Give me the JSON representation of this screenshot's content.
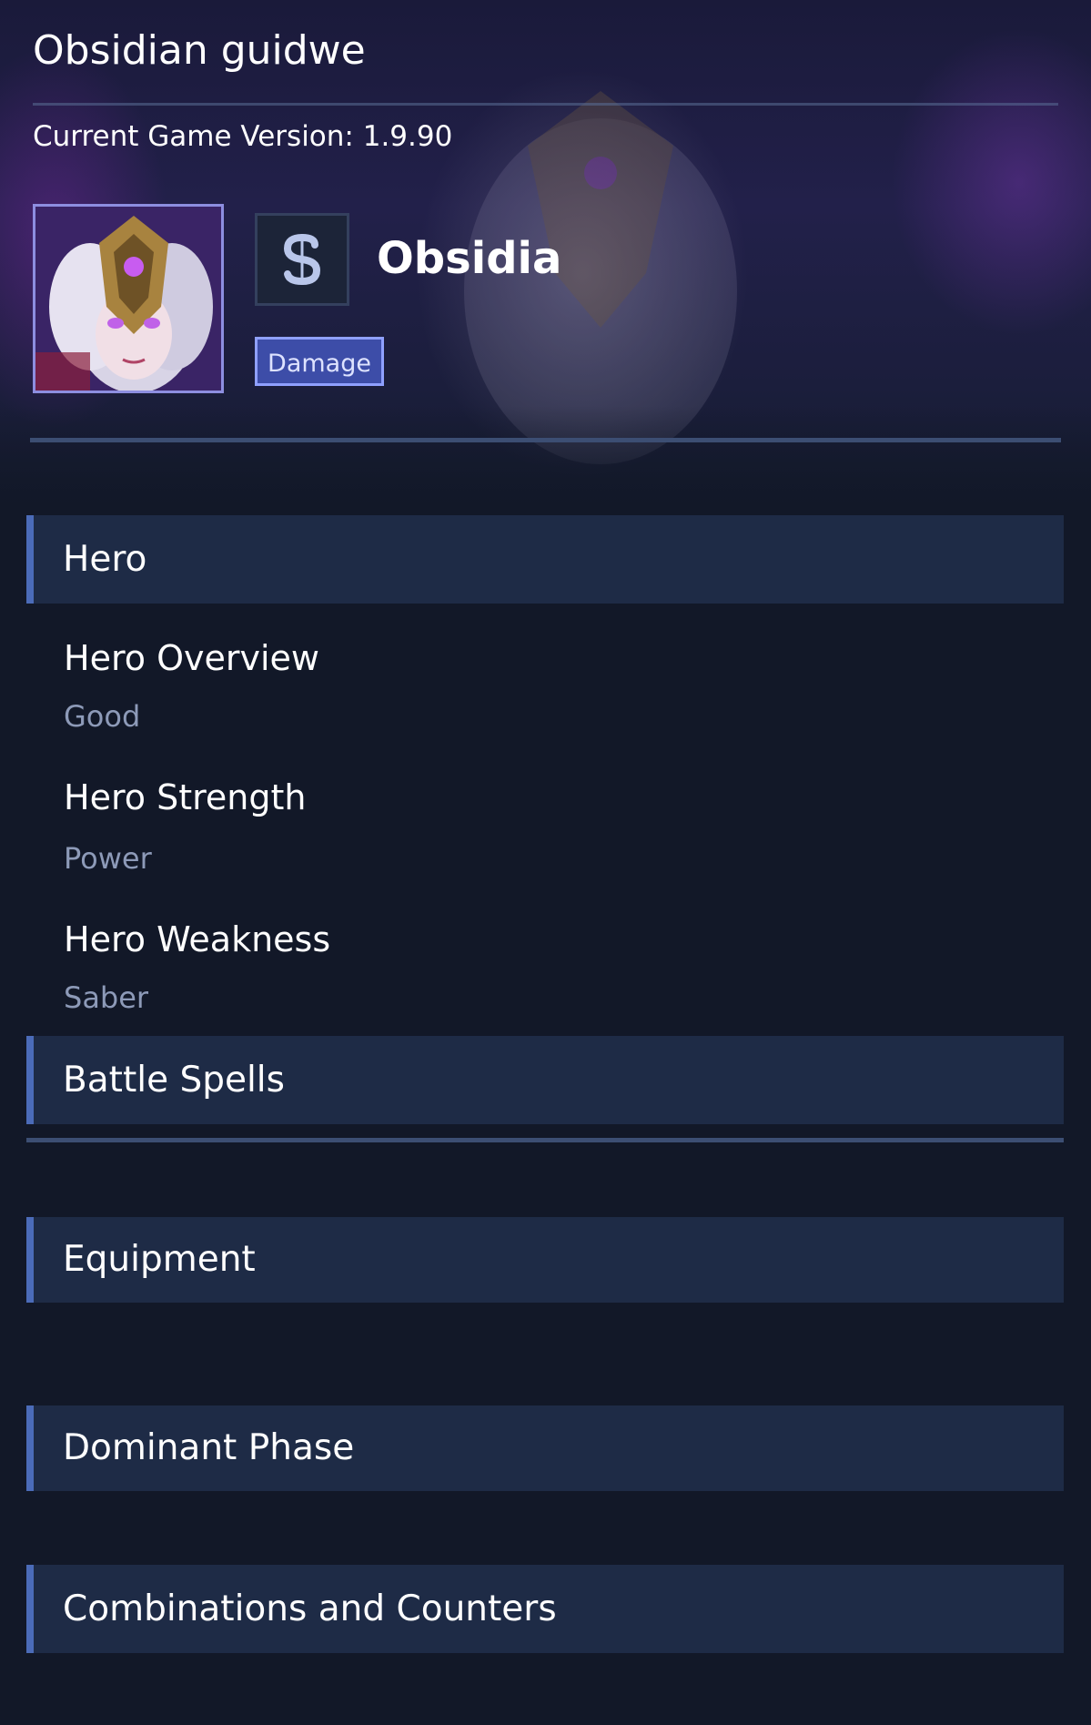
{
  "app": {
    "title": "Obsidian guidwe",
    "version_text": "Current Game Version: 1.9.90"
  },
  "hero_profile": {
    "name": "Obsidia",
    "role_badge": "Damage",
    "class_icon": "s-glyph-icon",
    "portrait": "hero-portrait-icon"
  },
  "colors": {
    "background": "#121828",
    "section_header_bg": "#1e2b46",
    "section_accent": "#4b6bb8",
    "badge_bg": "#3d4da8",
    "badge_border": "#8fa0ff",
    "subtext": "#8d9ab8"
  },
  "sections": {
    "hero": {
      "label": "Hero",
      "items": [
        {
          "title": "Hero Overview",
          "value": "Good"
        },
        {
          "title": "Hero Strength",
          "value": "Power"
        },
        {
          "title": "Hero Weakness",
          "value": "Saber"
        }
      ]
    },
    "battle_spells": {
      "label": "Battle Spells"
    },
    "equipment": {
      "label": "Equipment"
    },
    "dominant_phase": {
      "label": "Dominant Phase"
    },
    "combinations": {
      "label": "Combinations and Counters"
    }
  }
}
